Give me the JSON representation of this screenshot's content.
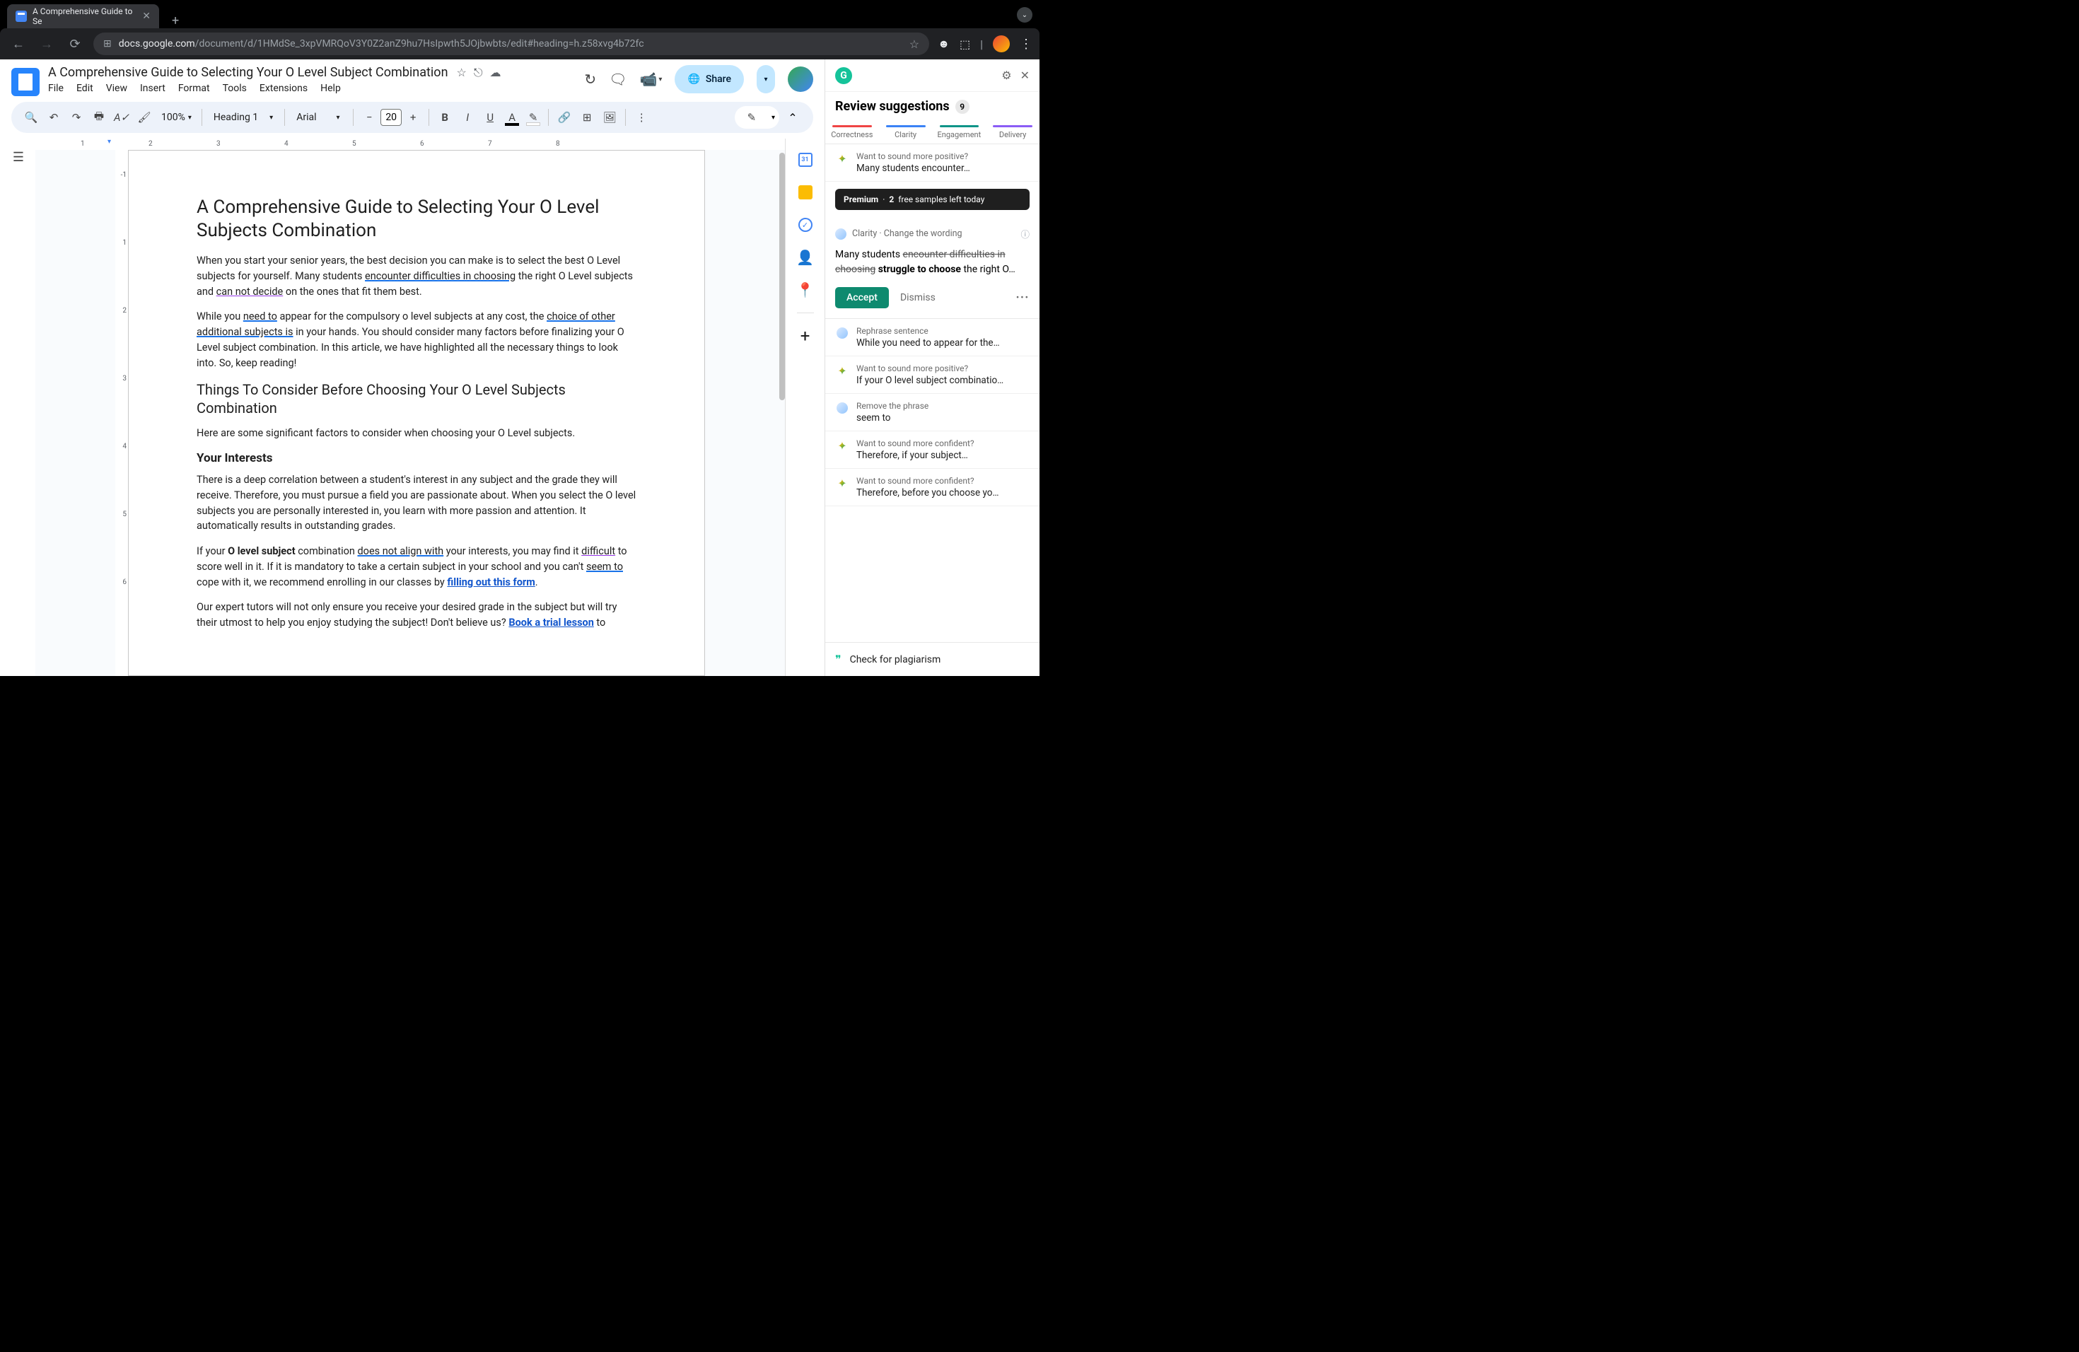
{
  "browser": {
    "tab_title": "A Comprehensive Guide to Se",
    "url_domain": "docs.google.com",
    "url_path": "/document/d/1HMdSe_3xpVMRQoV3Y0Z2anZ9hu7HsIpwth5JOjbwbts/edit#heading=h.z58xvg4b72fc"
  },
  "docs": {
    "title": "A Comprehensive Guide to Selecting Your O Level Subject Combination",
    "menu": {
      "file": "File",
      "edit": "Edit",
      "view": "View",
      "insert": "Insert",
      "format": "Format",
      "tools": "Tools",
      "extensions": "Extensions",
      "help": "Help"
    },
    "share": "Share"
  },
  "toolbar": {
    "zoom": "100%",
    "style": "Heading 1",
    "font": "Arial",
    "font_size": "20"
  },
  "ruler": {
    "h": [
      "1",
      "2",
      "3",
      "4",
      "5",
      "6",
      "7",
      "8"
    ],
    "v": [
      "-1",
      "1",
      "2",
      "3",
      "4",
      "5",
      "6"
    ]
  },
  "document": {
    "h1": "A Comprehensive Guide to Selecting Your O Level Subjects Combination",
    "p1a": "When you start your senior years, the best decision you can make is to select the best O Level subjects for yourself. Many students ",
    "p1b": "encounter difficulties in choosing",
    "p1c": " the right O Level subjects and ",
    "p1d": "can not decide",
    "p1e": " on the ones that fit them best.",
    "p2a": "While you ",
    "p2b": "need to",
    "p2c": " appear for the compulsory o level subjects at any cost, the ",
    "p2d": "choice of other additional subjects is",
    "p2e": " in your hands. You should consider many factors before finalizing your O Level subject combination. In this article, we have highlighted all the necessary things to look into. So, keep reading!",
    "h2": "Things To Consider Before Choosing Your O Level Subjects Combination",
    "p3": "Here are some significant factors to consider when choosing your O Level subjects.",
    "h3": "Your Interests",
    "p4": "There is a deep correlation between a student's interest in any subject and the grade they will receive. Therefore, you must pursue a field you are passionate about. When you select the O level subjects you are personally interested in, you learn with more passion and attention. It automatically results in outstanding grades.",
    "p5a": "If your ",
    "p5b": "O level subject",
    "p5c": " combination ",
    "p5d": "does not align with",
    "p5e": " your interests, you may find it ",
    "p5f": "difficult",
    "p5g": " to score well in it. If it is mandatory to take a certain subject in your school and you can't ",
    "p5h": "seem to",
    "p5i": " cope with it, we recommend enrolling in our classes by ",
    "p5j": "filling out this form",
    "p5k": ".",
    "p6a": "Our expert tutors will not only ensure you receive your desired grade in the subject but will try their utmost to help you enjoy studying the subject! Don't believe us? ",
    "p6b": "Book a trial lesson",
    "p6c": " to"
  },
  "grammarly": {
    "title": "Review suggestions",
    "count": "9",
    "tabs": {
      "correctness": "Correctness",
      "clarity": "Clarity",
      "engagement": "Engagement",
      "delivery": "Delivery"
    },
    "card1": {
      "label": "Want to sound more positive?",
      "text": "Many students encounter…"
    },
    "premium": {
      "label": "Premium",
      "sep": "·",
      "count": "2",
      "rest": "free samples left today"
    },
    "expanded": {
      "category": "Clarity · Change the wording",
      "prefix": "Many students ",
      "strike": "encounter difficulties in choosing",
      "bold": " struggle to choose",
      "suffix": " the right O…",
      "accept": "Accept",
      "dismiss": "Dismiss"
    },
    "cards": [
      {
        "label": "Rephrase sentence",
        "text": "While you need to appear for the…",
        "icon": "clarity"
      },
      {
        "label": "Want to sound more positive?",
        "text": "If your O level subject combinatio…",
        "icon": "sparkle"
      },
      {
        "label": "Remove the phrase",
        "text": "seem to",
        "icon": "clarity"
      },
      {
        "label": "Want to sound more confident?",
        "text": "Therefore, if your subject…",
        "icon": "sparkle"
      },
      {
        "label": "Want to sound more confident?",
        "text": "Therefore, before you choose yo…",
        "icon": "sparkle"
      }
    ],
    "footer": "Check for plagiarism"
  }
}
